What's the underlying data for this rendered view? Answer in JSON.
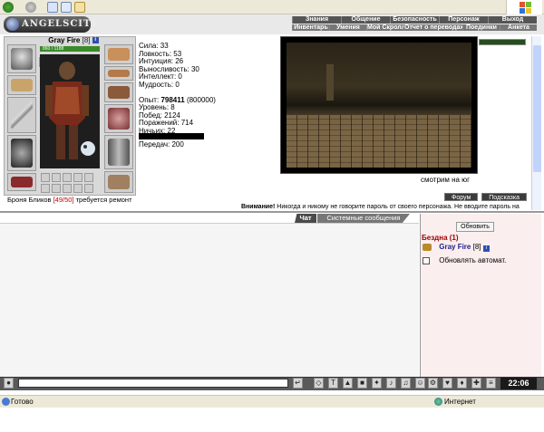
{
  "browser": {
    "status_text": "Готово",
    "zone_text": "Интернет"
  },
  "header": {
    "logo_text": "ANGELSCITY",
    "nav_top": [
      "Знания",
      "Общение",
      "Безопасность",
      "Персонаж",
      "Выход"
    ],
    "nav_bottom": [
      "Инвентарь",
      "Умения",
      "Мой Скролл",
      "Отчет о переводах",
      "Поединки",
      "Анкета"
    ]
  },
  "character": {
    "name": "Gray Fire",
    "level_tag": "[8]",
    "info_icon": "i",
    "hp_text": "860 / 1188",
    "armor_label": "Броня Бликов",
    "armor_status": "[49/50]",
    "armor_note": "требуется ремонт"
  },
  "stats": {
    "strength": "Сила: 33",
    "agility": "Ловкость: 53",
    "intuition": "Интуиция: 26",
    "endurance": "Выносливость: 30",
    "intellect": "Интеллект: 0",
    "wisdom": "Мудрость: 0",
    "exp_label": "Опыт:",
    "exp_value": "798411",
    "exp_next": "(800000)",
    "level": "Уровень: 8",
    "wins": "Побед: 2124",
    "losses": "Поражений: 714",
    "draws": "Ничьих: 22",
    "transfers": "Передач: 200"
  },
  "scene": {
    "caption": "смотрим на юг"
  },
  "actions": {
    "forum_label": "Форум",
    "hint_label": "Подсказка"
  },
  "warning": {
    "bold": "Внимание!",
    "text": " Никогда и никому не говорите пароль от своего персонажа. Не вводите пароль на"
  },
  "chat": {
    "tab_chat": "Чат",
    "tab_system": "Системные сообщения"
  },
  "users": {
    "refresh_label": "Обновить",
    "location": "Бездна (1)",
    "user_name": "Gray Fire",
    "user_level": "[8]",
    "info_icon": "i",
    "auto_refresh_label": "Обновлять автомат."
  },
  "bottom": {
    "clock": "22:06"
  },
  "colors": {
    "warning_red": "#c00000",
    "location_red": "#a00000",
    "hp_green": "#3a8a2a",
    "users_bg": "#fbeeee"
  }
}
